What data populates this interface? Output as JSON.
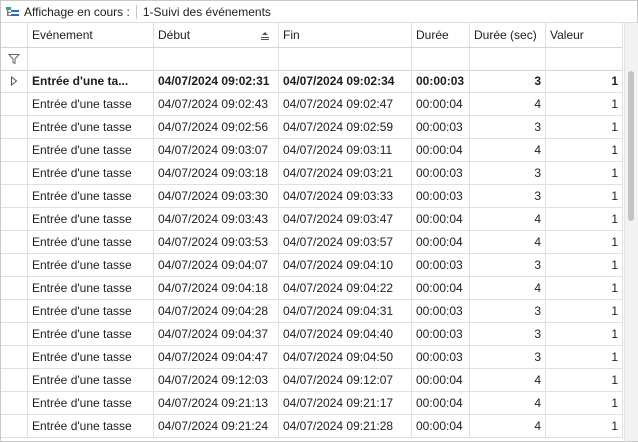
{
  "toolbar": {
    "icon": "view-layout-icon",
    "current_view_label": "Affichage en cours :",
    "current_view_value": "1-Suivi des événements"
  },
  "columns": [
    "Evénement",
    "Début",
    "Fin",
    "Durée",
    "Durée (sec)",
    "Valeur"
  ],
  "sorted_column": "Début",
  "rows": [
    {
      "evenement": "Entrée d'une ta...",
      "debut": "04/07/2024 09:02:31",
      "fin": "04/07/2024 09:02:34",
      "duree": "00:00:03",
      "duree_sec": "3",
      "valeur": "1",
      "selected": true
    },
    {
      "evenement": "Entrée d'une tasse",
      "debut": "04/07/2024 09:02:43",
      "fin": "04/07/2024 09:02:47",
      "duree": "00:00:04",
      "duree_sec": "4",
      "valeur": "1"
    },
    {
      "evenement": "Entrée d'une tasse",
      "debut": "04/07/2024 09:02:56",
      "fin": "04/07/2024 09:02:59",
      "duree": "00:00:03",
      "duree_sec": "3",
      "valeur": "1"
    },
    {
      "evenement": "Entrée d'une tasse",
      "debut": "04/07/2024 09:03:07",
      "fin": "04/07/2024 09:03:11",
      "duree": "00:00:04",
      "duree_sec": "4",
      "valeur": "1"
    },
    {
      "evenement": "Entrée d'une tasse",
      "debut": "04/07/2024 09:03:18",
      "fin": "04/07/2024 09:03:21",
      "duree": "00:00:03",
      "duree_sec": "3",
      "valeur": "1"
    },
    {
      "evenement": "Entrée d'une tasse",
      "debut": "04/07/2024 09:03:30",
      "fin": "04/07/2024 09:03:33",
      "duree": "00:00:03",
      "duree_sec": "3",
      "valeur": "1"
    },
    {
      "evenement": "Entrée d'une tasse",
      "debut": "04/07/2024 09:03:43",
      "fin": "04/07/2024 09:03:47",
      "duree": "00:00:04",
      "duree_sec": "4",
      "valeur": "1"
    },
    {
      "evenement": "Entrée d'une tasse",
      "debut": "04/07/2024 09:03:53",
      "fin": "04/07/2024 09:03:57",
      "duree": "00:00:04",
      "duree_sec": "4",
      "valeur": "1"
    },
    {
      "evenement": "Entrée d'une tasse",
      "debut": "04/07/2024 09:04:07",
      "fin": "04/07/2024 09:04:10",
      "duree": "00:00:03",
      "duree_sec": "3",
      "valeur": "1"
    },
    {
      "evenement": "Entrée d'une tasse",
      "debut": "04/07/2024 09:04:18",
      "fin": "04/07/2024 09:04:22",
      "duree": "00:00:04",
      "duree_sec": "4",
      "valeur": "1"
    },
    {
      "evenement": "Entrée d'une tasse",
      "debut": "04/07/2024 09:04:28",
      "fin": "04/07/2024 09:04:31",
      "duree": "00:00:03",
      "duree_sec": "3",
      "valeur": "1"
    },
    {
      "evenement": "Entrée d'une tasse",
      "debut": "04/07/2024 09:04:37",
      "fin": "04/07/2024 09:04:40",
      "duree": "00:00:03",
      "duree_sec": "3",
      "valeur": "1"
    },
    {
      "evenement": "Entrée d'une tasse",
      "debut": "04/07/2024 09:04:47",
      "fin": "04/07/2024 09:04:50",
      "duree": "00:00:03",
      "duree_sec": "3",
      "valeur": "1"
    },
    {
      "evenement": "Entrée d'une tasse",
      "debut": "04/07/2024 09:12:03",
      "fin": "04/07/2024 09:12:07",
      "duree": "00:00:04",
      "duree_sec": "4",
      "valeur": "1"
    },
    {
      "evenement": "Entrée d'une tasse",
      "debut": "04/07/2024 09:21:13",
      "fin": "04/07/2024 09:21:17",
      "duree": "00:00:04",
      "duree_sec": "4",
      "valeur": "1"
    },
    {
      "evenement": "Entrée d'une tasse",
      "debut": "04/07/2024 09:21:24",
      "fin": "04/07/2024 09:21:28",
      "duree": "00:00:04",
      "duree_sec": "4",
      "valeur": "1"
    }
  ],
  "colors": {
    "grid_line": "#e0e0e0",
    "header_border": "#d4d4d4",
    "icon_blue": "#2b6cc4",
    "icon_teal": "#3aa0a0"
  }
}
